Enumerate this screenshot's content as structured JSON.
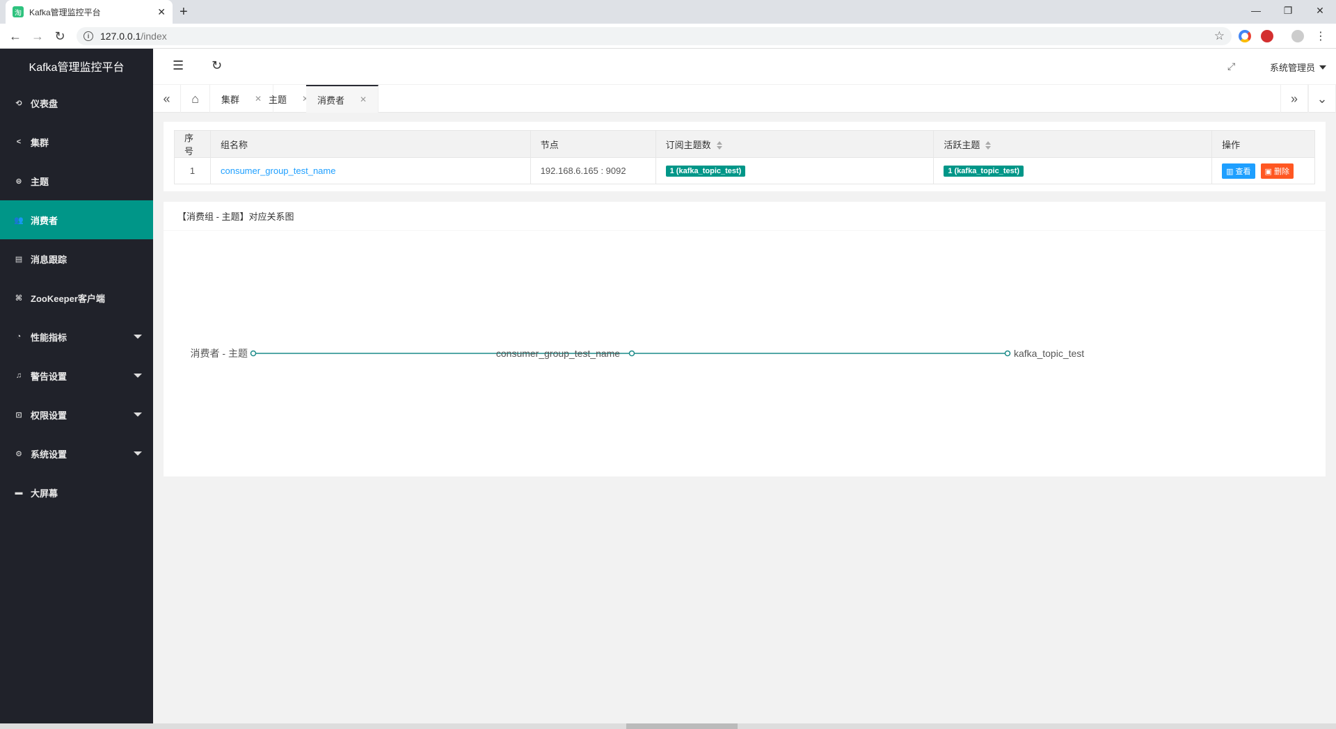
{
  "browser": {
    "tab_title": "Kafka管理监控平台",
    "tab_favicon": "淘",
    "url_host": "127.0.0.1",
    "url_path": "/index"
  },
  "sidebar": {
    "logo": "Kafka管理监控平台",
    "items": [
      {
        "label": "仪表盘",
        "icon": "dashboard-icon",
        "glyph": "⟲",
        "has_caret": false,
        "active": false
      },
      {
        "label": "集群",
        "icon": "share-icon",
        "glyph": "<",
        "has_caret": false,
        "active": false
      },
      {
        "label": "主题",
        "icon": "topic-icon",
        "glyph": "⊜",
        "has_caret": false,
        "active": false
      },
      {
        "label": "消费者",
        "icon": "users-icon",
        "glyph": "👥",
        "has_caret": false,
        "active": true
      },
      {
        "label": "消息跟踪",
        "icon": "file-icon",
        "glyph": "▤",
        "has_caret": false,
        "active": false
      },
      {
        "label": "ZooKeeper客户端",
        "icon": "tree-icon",
        "glyph": "⌘",
        "has_caret": false,
        "active": false
      },
      {
        "label": "性能指标",
        "icon": "gauge-icon",
        "glyph": "◔",
        "has_caret": true,
        "active": false
      },
      {
        "label": "警告设置",
        "icon": "bell-icon",
        "glyph": "♫",
        "has_caret": true,
        "active": false
      },
      {
        "label": "权限设置",
        "icon": "lock-icon",
        "glyph": "⊡",
        "has_caret": true,
        "active": false
      },
      {
        "label": "系统设置",
        "icon": "gear-icon",
        "glyph": "⚙",
        "has_caret": true,
        "active": false
      },
      {
        "label": "大屏幕",
        "icon": "screen-icon",
        "glyph": "▬",
        "has_caret": false,
        "active": false
      }
    ]
  },
  "header": {
    "user": "系统管理员"
  },
  "page_tabs": [
    {
      "label": "集群",
      "closable": true,
      "active": false
    },
    {
      "label": "主题",
      "closable": true,
      "active": false
    },
    {
      "label": "消费者",
      "closable": true,
      "active": true
    }
  ],
  "table": {
    "headers": [
      "序号",
      "组名称",
      "节点",
      "订阅主题数",
      "活跃主题",
      "操作"
    ],
    "rows": [
      {
        "index": "1",
        "group": "consumer_group_test_name",
        "node": "192.168.6.165 : 9092",
        "subscribed": "1 (kafka_topic_test)",
        "active": "1 (kafka_topic_test)",
        "view_label": "查看",
        "delete_label": "删除"
      }
    ]
  },
  "graph": {
    "title": "【消费组 - 主题】对应关系图",
    "root": "消费者 - 主题",
    "group": "consumer_group_test_name",
    "topic": "kafka_topic_test"
  },
  "colors": {
    "sidebar_bg": "#20222a",
    "accent": "#009688",
    "link": "#1E9FFF",
    "danger": "#FF5722"
  }
}
